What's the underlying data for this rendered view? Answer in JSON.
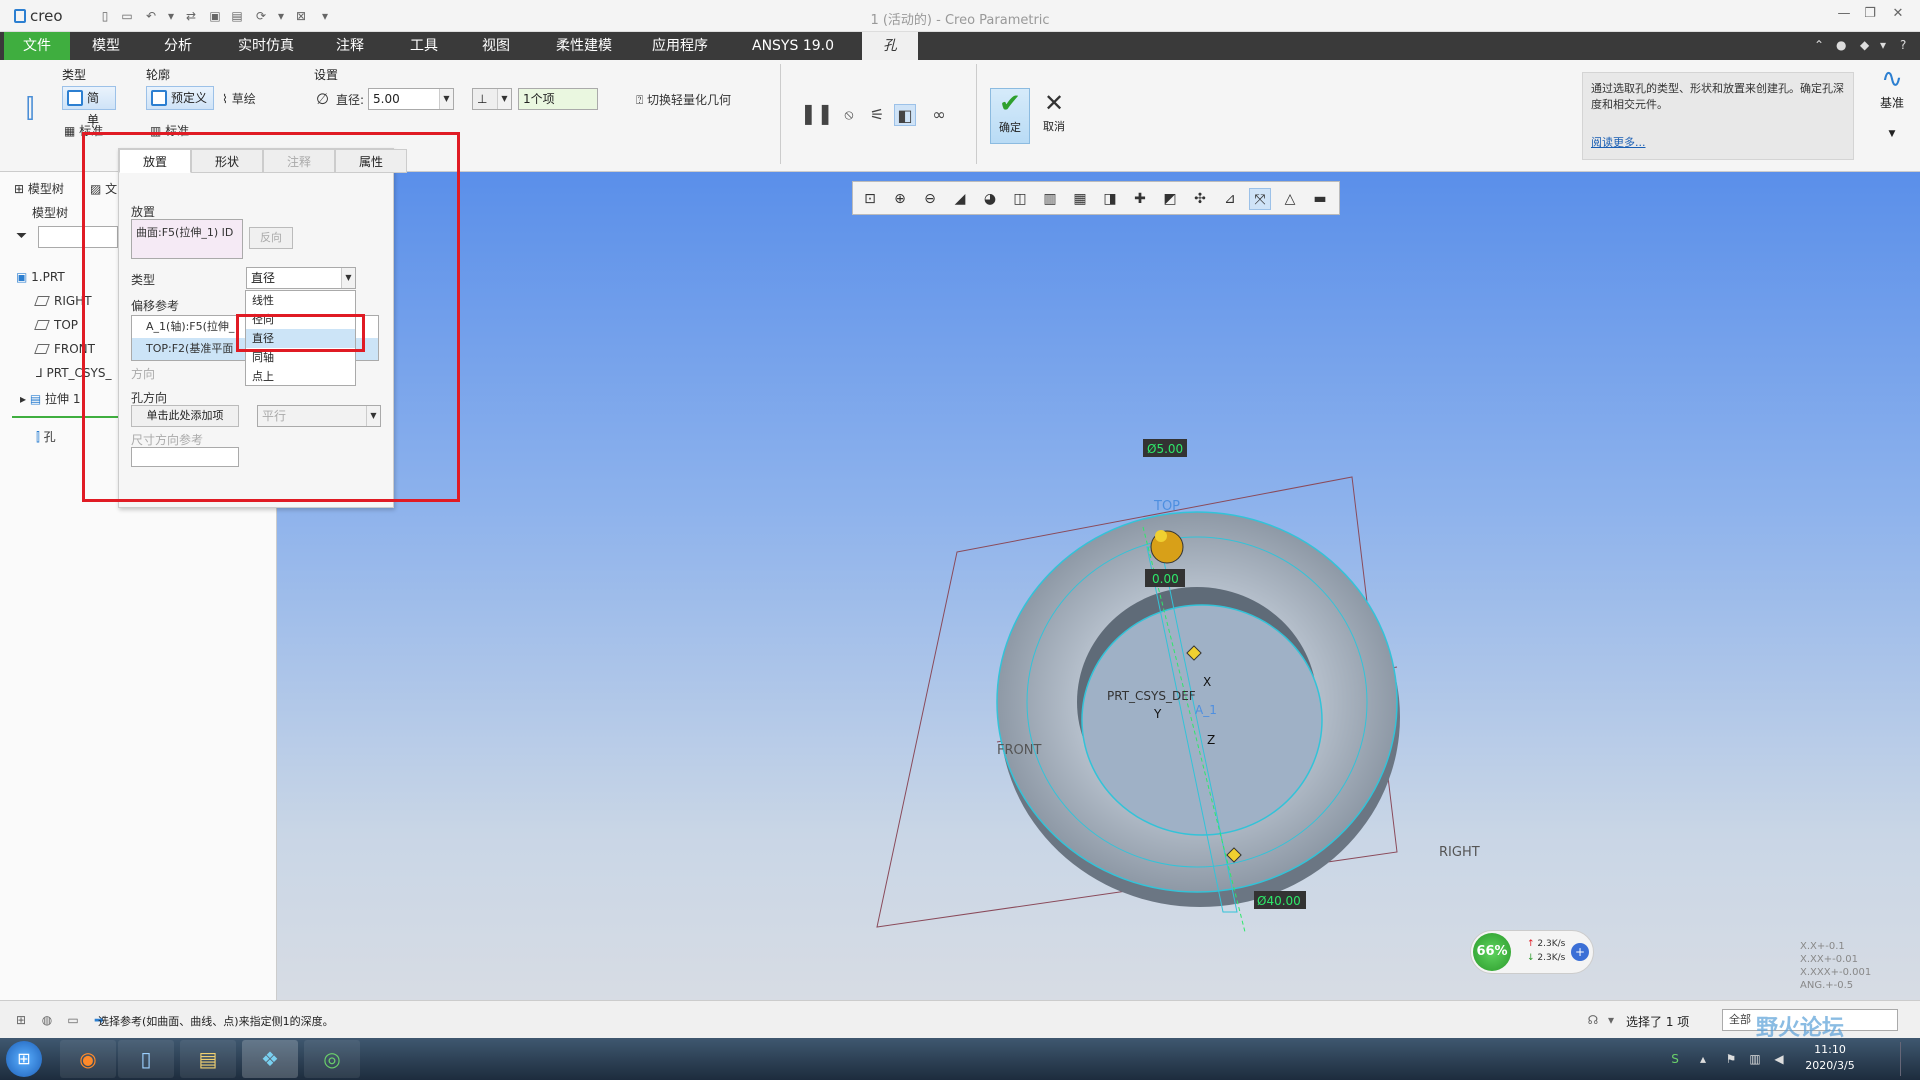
{
  "titlebar": {
    "app_name": "creo",
    "title": "1 (活动的) - Creo Parametric"
  },
  "tabs": [
    "文件",
    "模型",
    "分析",
    "实时仿真",
    "注释",
    "工具",
    "视图",
    "柔性建模",
    "应用程序",
    "ANSYS 19.0",
    "孔"
  ],
  "ribbon": {
    "type_group": "类型",
    "simple": "简单",
    "standard": "标准",
    "profile_group": "轮廓",
    "predefined": "预定义",
    "sketch": "草绘",
    "profile_standard": "标准",
    "settings_group": "设置",
    "diameter_label": "直径:",
    "diameter_value": "5.00",
    "depth_value": "1个项",
    "lightweight": "切换轻量化几何",
    "ok": "确定",
    "cancel": "取消",
    "help_text": "通过选取孔的类型、形状和放置来创建孔。确定孔深度和相交元件。",
    "help_link": "阅读更多...",
    "datum": "基准"
  },
  "left_panel": {
    "tab_model_tree": "模型树",
    "tab_other": "文",
    "subtitle": "模型树",
    "items": [
      "1.PRT",
      "RIGHT",
      "TOP",
      "FRONT",
      "PRT_CSYS_",
      "拉伸 1",
      "孔"
    ]
  },
  "placement_panel": {
    "tabs": [
      "放置",
      "形状",
      "注释",
      "属性"
    ],
    "placement_label": "放置",
    "placement_ref": "曲面:F5(拉伸_1) ID",
    "flip": "反向",
    "type_label": "类型",
    "type_value": "直径",
    "offset_label": "偏移参考",
    "offset_refs": [
      "A_1(轴):F5(拉伸_",
      "TOP:F2(基准平面"
    ],
    "direction_label": "方向",
    "hole_dir_label": "孔方向",
    "hole_dir_btn": "单击此处添加项",
    "parallel": "平行",
    "dim_dir_label": "尺寸方向参考",
    "type_options": [
      "线性",
      "径向",
      "直径",
      "同轴",
      "点上"
    ],
    "type_selected": "直径"
  },
  "model": {
    "dim_top": "Ø5.00",
    "dim_mid": "0.00",
    "dim_bottom": "Ø40.00",
    "label_top": "TOP",
    "label_front": "FRONT",
    "label_right": "RIGHT",
    "label_csys": "PRT_CSYS_DEF",
    "label_axis": "A_1",
    "x": "X",
    "y": "Y",
    "z": "Z"
  },
  "speed": {
    "percent": "66%",
    "up": "2.3K/s",
    "down": "2.3K/s"
  },
  "coords": [
    "X.X+-0.1",
    "X.XX+-0.01",
    "X.XXX+-0.001",
    "ANG.+-0.5"
  ],
  "status": {
    "message": "选择参考(如曲面、曲线、点)来指定侧1的深度。",
    "selected": "选择了 1 项",
    "filter": "全部"
  },
  "taskbar": {
    "time": "11:10",
    "date": "2020/3/5"
  },
  "watermark": "野火论坛",
  "colors": {
    "accent_green": "#3fae3f",
    "highlight_red": "#e01b24",
    "model_cyan": "#33c3d8",
    "dim_green": "#2ee86a"
  }
}
